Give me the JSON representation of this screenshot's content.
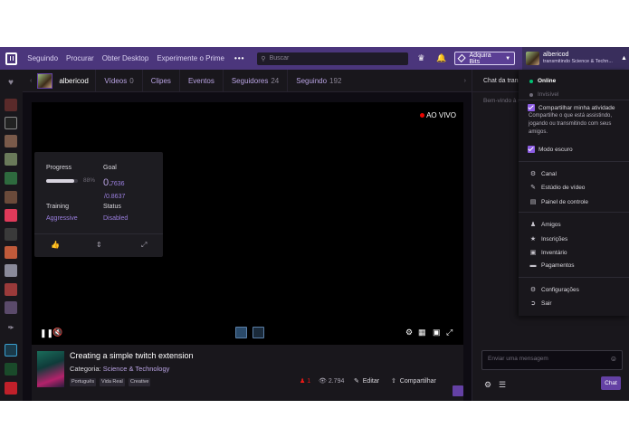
{
  "nav": {
    "links": [
      "Seguindo",
      "Procurar",
      "Obter Desktop",
      "Experimente o Prime"
    ],
    "more": "•••",
    "search_placeholder": "Buscar",
    "bits_label": "Adquira Bits",
    "user_name": "albericod",
    "user_status": "transmitindo Science & Techn..."
  },
  "channel": {
    "name": "albericod",
    "tabs": [
      {
        "label": "Vídeos",
        "count": "0"
      },
      {
        "label": "Clipes",
        "count": ""
      },
      {
        "label": "Eventos",
        "count": ""
      },
      {
        "label": "Seguidores",
        "count": "24"
      },
      {
        "label": "Seguindo",
        "count": "192"
      }
    ]
  },
  "player": {
    "live_label": "AO VIVO",
    "overlay": {
      "progress_label": "Progress",
      "progress_fraction": 0.88,
      "progress_pct": "88%",
      "goal_label": "Goal",
      "goal_big": "0.",
      "goal_value": "7636",
      "goal_total": "/0.8637",
      "training_label": "Training",
      "training_value": "Aggressive",
      "status_label": "Status",
      "status_value": "Disabled"
    }
  },
  "stream": {
    "title": "Creating a simple twitch extension",
    "category_label": "Categoria:",
    "category": "Science & Technology",
    "tags": [
      "Português",
      "Vida Real",
      "Creative"
    ],
    "viewers": "1",
    "views": "2.794",
    "edit_label": "Editar",
    "share_label": "Compartilhar"
  },
  "chat": {
    "header": "Chat da transmissão",
    "welcome": "Bem-vindo à sala de chat!",
    "input_placeholder": "Enviar uma mensagem",
    "send_label": "Chat"
  },
  "menu": {
    "online": "Online",
    "invisible": "Invisível",
    "share_activity": "Compartilhar minha atividade",
    "share_desc": "Compartilhe o que está assistindo, jogando ou transmitindo com seus amigos.",
    "dark_mode": "Modo escuro",
    "items_a": [
      "Canal",
      "Estúdio de vídeo",
      "Painel de controle"
    ],
    "items_b": [
      "Amigos",
      "Inscrições",
      "Inventário",
      "Pagamentos"
    ],
    "items_c": [
      "Configurações",
      "Sair"
    ]
  },
  "colors": {
    "brand": "#6441a4",
    "nav": "#4b367c",
    "live": "#eb0400",
    "online": "#00c274"
  }
}
